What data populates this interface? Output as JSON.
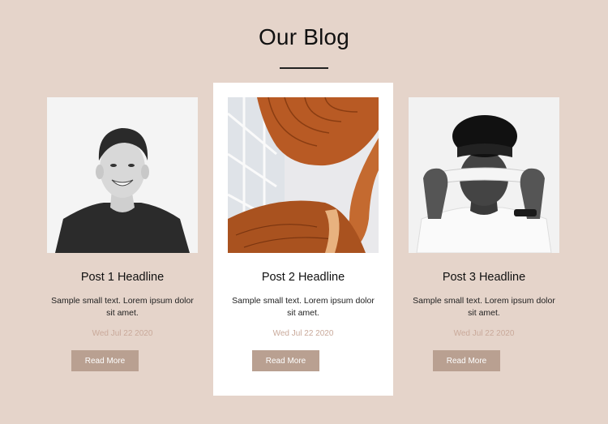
{
  "section": {
    "title": "Our Blog"
  },
  "posts": [
    {
      "headline": "Post 1 Headline",
      "excerpt": "Sample small text. Lorem ipsum dolor sit amet.",
      "date": "Wed Jul 22 2020",
      "button_label": "Read More",
      "image_icon": "smiling-man-photo"
    },
    {
      "headline": "Post 2 Headline",
      "excerpt": "Sample small text. Lorem ipsum dolor sit amet.",
      "date": "Wed Jul 22 2020",
      "button_label": "Read More",
      "image_icon": "spiral-staircase-photo"
    },
    {
      "headline": "Post 3 Headline",
      "excerpt": "Sample small text. Lorem ipsum dolor sit amet.",
      "date": "Wed Jul 22 2020",
      "button_label": "Read More",
      "image_icon": "blindfolded-man-photo"
    }
  ],
  "colors": {
    "background": "#e5d4ca",
    "card_featured": "#ffffff",
    "button": "#b9a091",
    "date_text": "#c9a99a"
  }
}
